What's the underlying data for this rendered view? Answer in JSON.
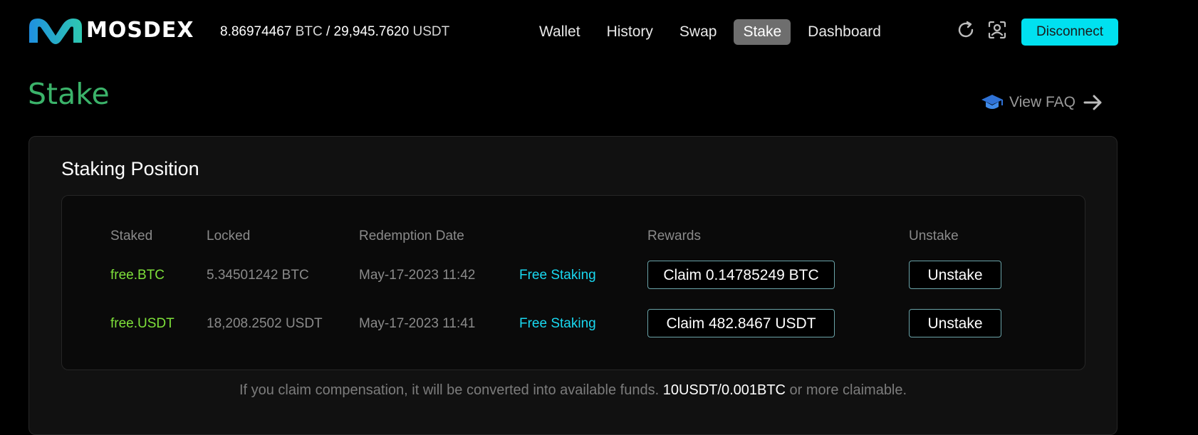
{
  "header": {
    "brand": "MOSDEX",
    "balance": {
      "btc_value": "8.86974467",
      "btc_unit": "BTC",
      "separator": "/",
      "usdt_value": "29,945.7620",
      "usdt_unit": "USDT"
    },
    "nav": [
      {
        "label": "Wallet",
        "active": false
      },
      {
        "label": "History",
        "active": false
      },
      {
        "label": "Swap",
        "active": false
      },
      {
        "label": "Stake",
        "active": true
      },
      {
        "label": "Dashboard",
        "active": false
      }
    ],
    "icons": [
      "refresh-icon",
      "account-icon"
    ],
    "disconnect_label": "Disconnect"
  },
  "page": {
    "title": "Stake",
    "faq_label": "View FAQ"
  },
  "staking": {
    "title": "Staking Position",
    "columns": {
      "staked": "Staked",
      "locked": "Locked",
      "redemption": "Redemption Date",
      "rewards": "Rewards",
      "unstake": "Unstake"
    },
    "rows": [
      {
        "token": "free.BTC",
        "locked": "5.34501242 BTC",
        "redemption_date": "May-17-2023 11:42",
        "type": "Free Staking",
        "claim_label": "Claim 0.14785249 BTC",
        "unstake_label": "Unstake"
      },
      {
        "token": "free.USDT",
        "locked": "18,208.2502 USDT",
        "redemption_date": "May-17-2023 11:41",
        "type": "Free Staking",
        "claim_label": "Claim 482.8467 USDT",
        "unstake_label": "Unstake"
      }
    ],
    "note": {
      "before": "If you claim compensation, it will be converted into available funds. ",
      "highlight": "10USDT/0.001BTC",
      "after": " or more claimable."
    }
  },
  "colors": {
    "background": "#000000",
    "accent_cyan": "#00e1f0",
    "title_green": "#3bb36a",
    "token_green": "#7ee03a",
    "type_cyan": "#19d8f0",
    "nav_active_bg": "#6e6e6e",
    "logo_blue": "#1f8fe0",
    "logo_teal": "#2ec8b0"
  }
}
